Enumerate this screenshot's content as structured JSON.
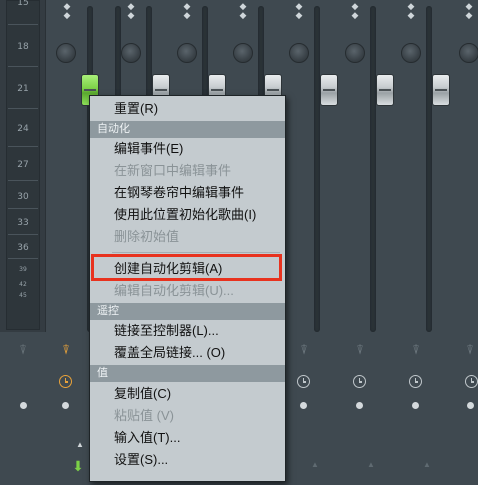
{
  "meter": {
    "db_labels": [
      "15",
      "18",
      "21",
      "24",
      "27",
      "30",
      "33",
      "36",
      "39",
      "42",
      "45"
    ]
  },
  "menu": {
    "items": [
      {
        "label": "重置(R)",
        "type": "item",
        "enabled": true
      },
      {
        "label": "自动化",
        "type": "header"
      },
      {
        "label": "编辑事件(E)",
        "type": "item",
        "enabled": true
      },
      {
        "label": "在新窗口中编辑事件",
        "type": "item",
        "enabled": false
      },
      {
        "label": "在钢琴卷帘中编辑事件",
        "type": "item",
        "enabled": true
      },
      {
        "label": "使用此位置初始化歌曲(I)",
        "type": "item",
        "enabled": true
      },
      {
        "label": "删除初始值",
        "type": "item",
        "enabled": false
      },
      {
        "label": "创建自动化剪辑(A)",
        "type": "item",
        "enabled": true,
        "highlighted": true
      },
      {
        "label": "编辑自动化剪辑(U)...",
        "type": "item",
        "enabled": false
      },
      {
        "label": "遥控",
        "type": "header"
      },
      {
        "label": "链接至控制器(L)...",
        "type": "item",
        "enabled": true
      },
      {
        "label": "覆盖全局链接... (O)",
        "type": "item",
        "enabled": true
      },
      {
        "label": "值",
        "type": "header"
      },
      {
        "label": "复制值(C)",
        "type": "item",
        "enabled": true
      },
      {
        "label": "粘贴值 (V)",
        "type": "item",
        "enabled": false
      },
      {
        "label": "输入值(T)...",
        "type": "item",
        "enabled": true
      },
      {
        "label": "设置(S)...",
        "type": "item",
        "enabled": true
      }
    ]
  },
  "colors": {
    "background": "#3f4950",
    "menu_bg": "#c4cbcf",
    "menu_header_bg": "#8e999f",
    "highlight_border": "#e8321e",
    "active_fader": "#7cd147",
    "active_icon": "#e8a23a"
  },
  "icons": {
    "automation_icon": "timer-clock",
    "link_icon": "plug",
    "pan_arrows": "left-right-arrows"
  }
}
